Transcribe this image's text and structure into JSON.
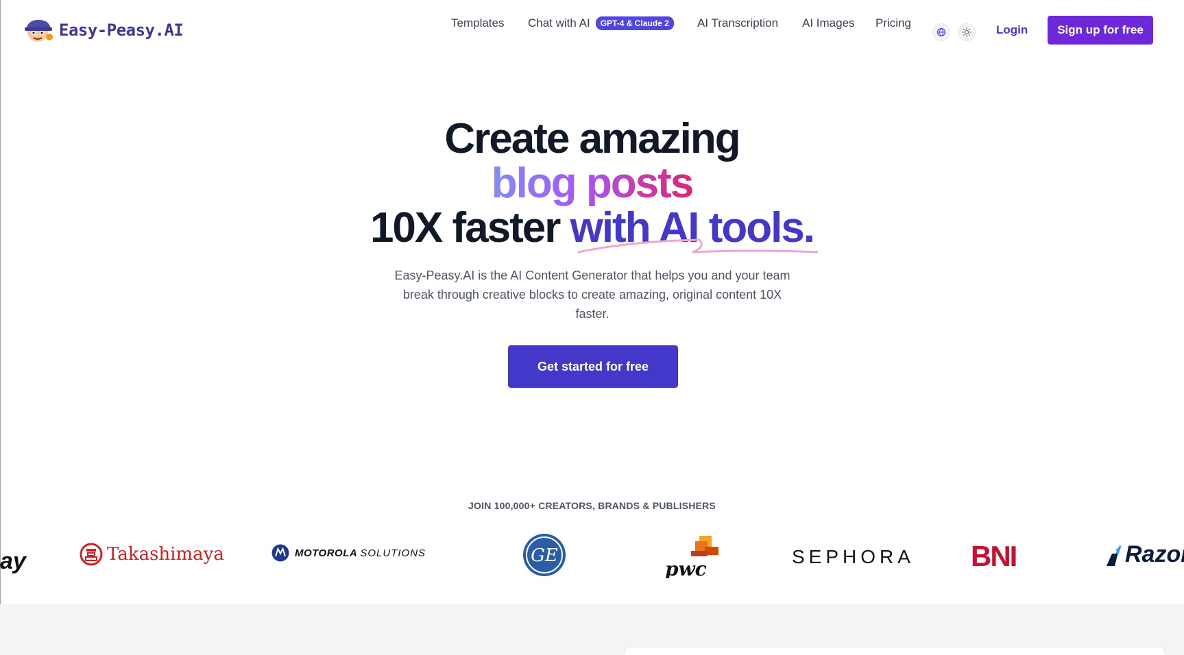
{
  "nav": {
    "logo_text": "Easy-Peasy.AI",
    "links": {
      "templates": "Templates",
      "chat": "Chat with AI",
      "chat_badge": "GPT-4 & Claude 2",
      "transcription": "AI Transcription",
      "images": "AI Images",
      "pricing": "Pricing"
    },
    "login": "Login",
    "signup": "Sign up for free"
  },
  "hero": {
    "line1": "Create amazing",
    "line2": "blog posts",
    "line3_plain": "10X faster ",
    "line3_accent": "with AI tools.",
    "subtext": "Easy-Peasy.AI is the AI Content Generator that helps you and your team break through creative blocks to create amazing, original content 10X faster.",
    "cta": "Get started for free"
  },
  "social_proof": {
    "heading": "JOIN 100,000+ CREATORS, BRANDS & PUBLISHERS",
    "brands": {
      "partial_left": "ay",
      "takashimaya": "Takashimaya",
      "motorola": "MOTOROLA",
      "motorola_suffix": "SOLUTIONS",
      "ge": "GE",
      "pwc": "pwc",
      "sephora": "SEPHORA",
      "bni": "BNI",
      "razor": "Razor"
    }
  },
  "colors": {
    "primary": "#4338ca",
    "signup": "#6d28d9",
    "gradient_start": "#818cf8",
    "gradient_end": "#db2777"
  }
}
